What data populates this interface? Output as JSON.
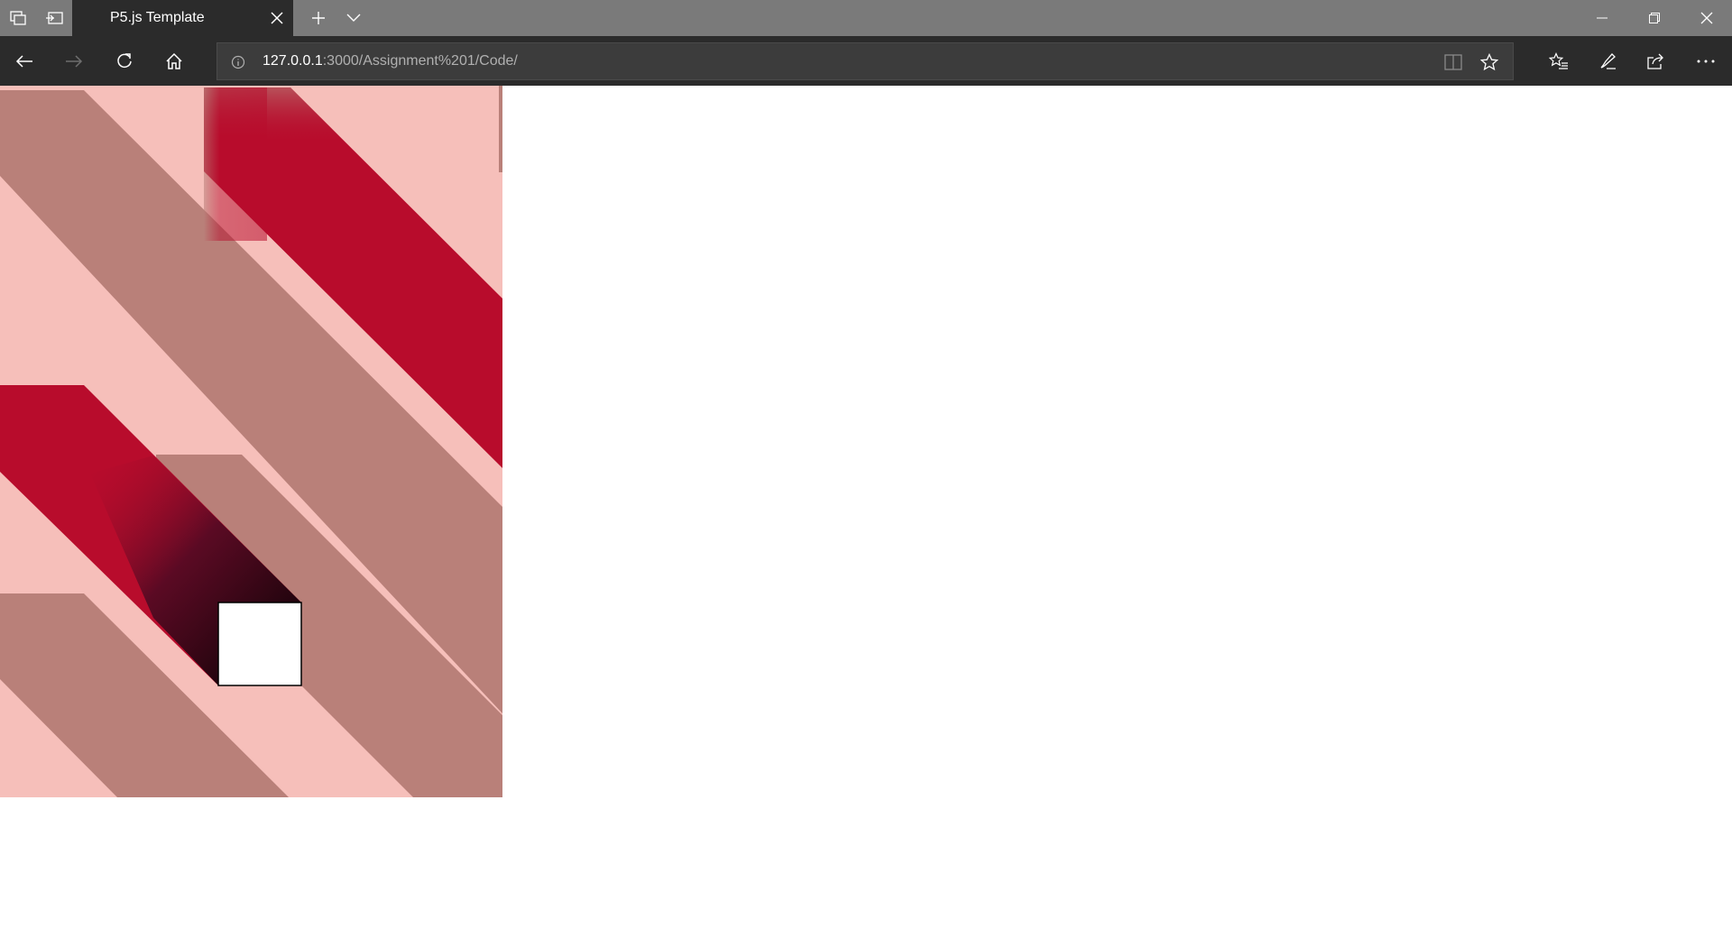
{
  "browser": {
    "tab": {
      "title": "P5.js Template"
    },
    "address_bar": {
      "url_host": "127.0.0.1",
      "url_rest": ":3000/Assignment%201/Code/"
    },
    "icons": {
      "tab_actions": "tab-set-aside-icon",
      "tab_preview": "tab-restore-icon",
      "new_tab": "plus-icon",
      "tab_list": "chevron-down-icon",
      "back": "arrow-left-icon",
      "forward": "arrow-right-icon",
      "refresh": "refresh-icon",
      "home": "home-icon",
      "site_info": "info-icon",
      "reading_view": "book-icon",
      "favorite": "star-icon",
      "favorites_hub": "favorites-list-icon",
      "notes": "pen-icon",
      "share": "share-icon",
      "more": "ellipsis-icon",
      "minimize": "minimize-icon",
      "restore": "restore-icon",
      "close": "close-icon"
    },
    "colors": {
      "tabbar": "#7a7a7a",
      "chrome": "#2b2b2b",
      "address_bg": "#3c3c3c"
    }
  },
  "sketch": {
    "colors": {
      "background": "#f6bfba",
      "band_muted": "#b98079",
      "band_red": "#b80c2c",
      "square": "#ffffff",
      "shadow": "#000000"
    }
  }
}
